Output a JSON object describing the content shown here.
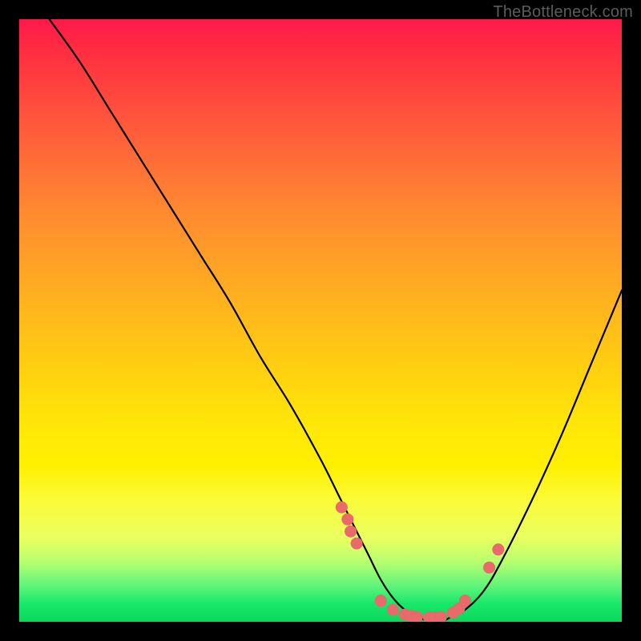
{
  "watermark": {
    "text": "TheBottleneck.com"
  },
  "colors": {
    "background": "#000000",
    "curve": "#000000",
    "dot": "#e86a6a",
    "gradient_top": "#ff1a4a",
    "gradient_bottom": "#0bd85c"
  },
  "chart_data": {
    "type": "line",
    "title": "",
    "xlabel": "",
    "ylabel": "",
    "xlim": [
      0,
      100
    ],
    "ylim": [
      0,
      100
    ],
    "grid": false,
    "legend": false,
    "series": [
      {
        "name": "bottleneck-curve",
        "x": [
          5,
          10,
          15,
          20,
          25,
          30,
          35,
          40,
          45,
          50,
          53,
          56,
          58,
          60,
          62,
          64,
          66,
          68,
          70,
          72,
          74,
          77,
          80,
          85,
          90,
          95,
          100
        ],
        "y": [
          100,
          93,
          85,
          77,
          69,
          61,
          53,
          44,
          36,
          27,
          21,
          15,
          11,
          7,
          4,
          2,
          1,
          0,
          0,
          1,
          2,
          5,
          10,
          20,
          31,
          43,
          55
        ]
      }
    ],
    "markers": {
      "name": "highlight-dots",
      "x": [
        53.5,
        54.5,
        55,
        56,
        60,
        62,
        64,
        65,
        66,
        68,
        69,
        70,
        72,
        73,
        74,
        78,
        79.5
      ],
      "y": [
        19,
        17,
        15,
        13,
        3.5,
        2,
        1.2,
        1,
        0.8,
        0.7,
        0.7,
        0.8,
        1.5,
        2.2,
        3.5,
        9,
        12
      ]
    }
  }
}
